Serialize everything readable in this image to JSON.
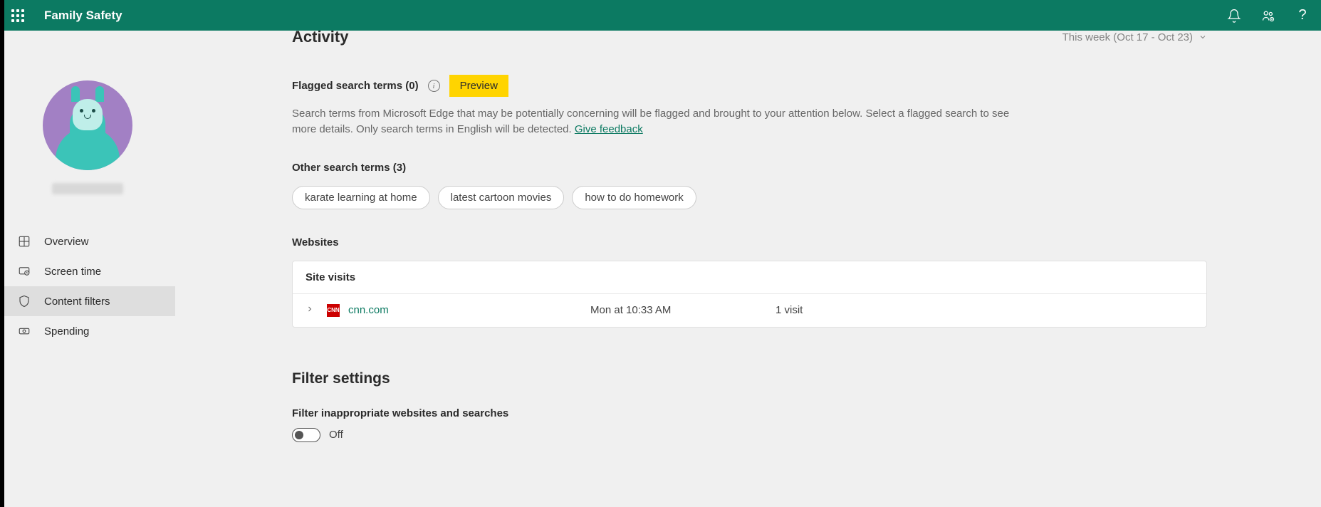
{
  "header": {
    "title": "Family Safety"
  },
  "sidebar": {
    "items": [
      {
        "label": "Overview",
        "icon": "overview-icon"
      },
      {
        "label": "Screen time",
        "icon": "screentime-icon"
      },
      {
        "label": "Content filters",
        "icon": "shield-icon"
      },
      {
        "label": "Spending",
        "icon": "money-icon"
      }
    ],
    "active_index": 2
  },
  "main": {
    "activity_title": "Activity",
    "week_range": "This week (Oct 17 - Oct 23)",
    "flagged_label": "Flagged search terms (0)",
    "preview_badge": "Preview",
    "description": "Search terms from Microsoft Edge that may be potentially concerning will be flagged and brought to your attention below. Select a flagged search to see more details. Only search terms in English will be detected. ",
    "feedback_link": "Give feedback",
    "other_label": "Other search terms (3)",
    "search_chips": [
      "karate learning at home",
      "latest cartoon movies",
      "how to do homework"
    ],
    "websites_label": "Websites",
    "site_visits_header": "Site visits",
    "sites": [
      {
        "favicon": "CNN",
        "name": "cnn.com",
        "time": "Mon at 10:33 AM",
        "visits": "1 visit"
      }
    ],
    "filter_settings_title": "Filter settings",
    "filter_sub_label": "Filter inappropriate websites and searches",
    "toggle_state": "Off"
  }
}
